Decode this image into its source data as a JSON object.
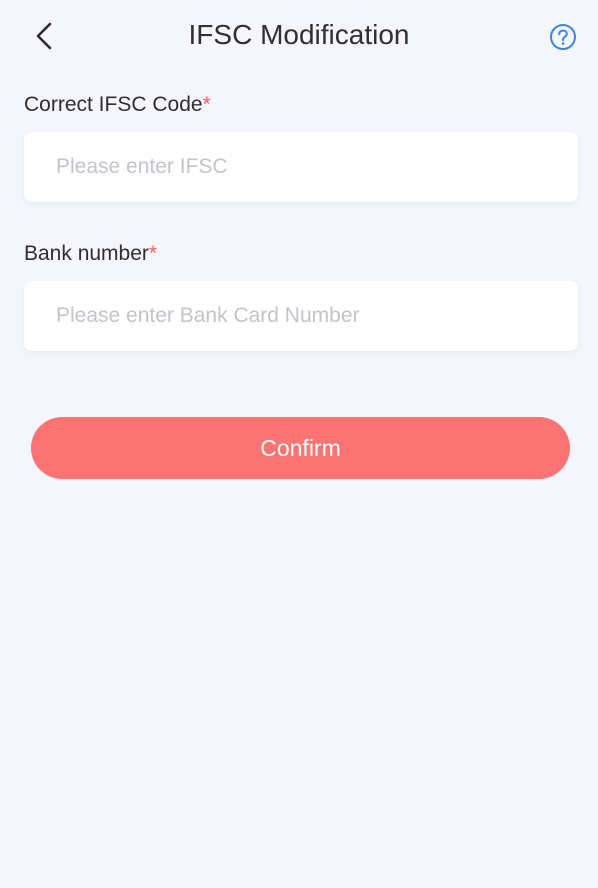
{
  "header": {
    "title": "IFSC Modification",
    "back_icon": "chevron-left-icon",
    "help_icon": "question-circle-icon"
  },
  "form": {
    "ifsc": {
      "label": "Correct IFSC Code",
      "required_mark": "*",
      "value": "",
      "placeholder": "Please enter IFSC"
    },
    "bank_number": {
      "label": "Bank number",
      "required_mark": "*",
      "value": "",
      "placeholder": "Please enter Bank Card Number"
    }
  },
  "actions": {
    "confirm_label": "Confirm"
  },
  "colors": {
    "background": "#f5f6fd",
    "accent": "#fb7373",
    "required": "#ff5a5a",
    "help_icon": "#3b87e0"
  }
}
